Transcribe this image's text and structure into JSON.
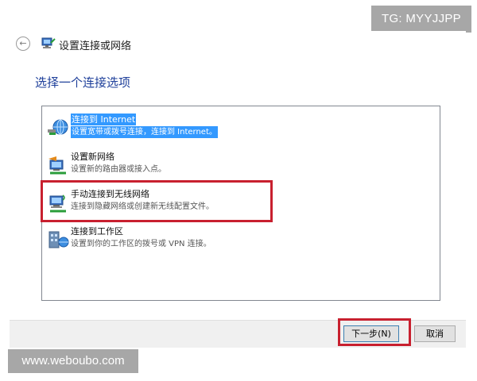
{
  "watermarks": {
    "top": "TG: MYYJJPP",
    "bottom": "www.weboubo.com"
  },
  "window": {
    "title": "设置连接或网络"
  },
  "content": {
    "heading": "选择一个连接选项"
  },
  "options": [
    {
      "title": "连接到 Internet",
      "desc": "设置宽带或拨号连接，连接到 Internet。",
      "icon": "globe-network-icon"
    },
    {
      "title": "设置新网络",
      "desc": "设置新的路由器或接入点。",
      "icon": "router-setup-icon"
    },
    {
      "title": "手动连接到无线网络",
      "desc": "连接到隐藏网络或创建新无线配置文件。",
      "icon": "wireless-network-icon"
    },
    {
      "title": "连接到工作区",
      "desc": "设置到你的工作区的拨号或 VPN 连接。",
      "icon": "workplace-vpn-icon"
    }
  ],
  "buttons": {
    "next": "下一步(N)",
    "cancel": "取消"
  },
  "colors": {
    "heading": "#1e3f9a",
    "selection": "#3399ff",
    "highlight": "#c8202f"
  }
}
